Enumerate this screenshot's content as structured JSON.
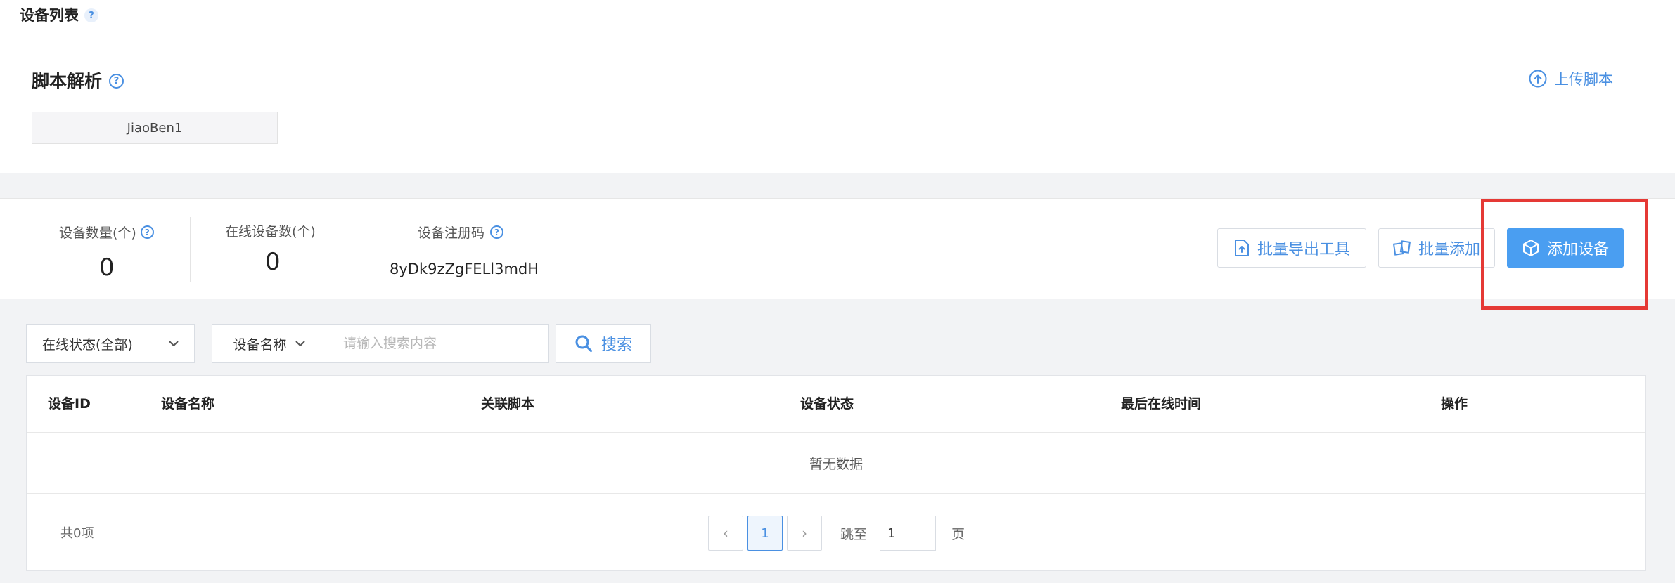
{
  "header": {
    "title": "设备列表",
    "help": "?"
  },
  "script_panel": {
    "title": "脚本解析",
    "help": "?",
    "script_name": "JiaoBen1",
    "upload_label": "上传脚本"
  },
  "stats": {
    "device_count_label": "设备数量(个)",
    "device_count_value": "0",
    "online_count_label": "在线设备数(个)",
    "online_count_value": "0",
    "reg_code_label": "设备注册码",
    "reg_code_value": "8yDk9zZgFELl3mdH",
    "help": "?"
  },
  "actions": {
    "export_tool": "批量导出工具",
    "batch_add": "批量添加",
    "add_device": "添加设备"
  },
  "filters": {
    "status_select": "在线状态(全部)",
    "field_select": "设备名称",
    "search_placeholder": "请输入搜索内容",
    "search_button": "搜索"
  },
  "table": {
    "columns": [
      "设备ID",
      "设备名称",
      "关联脚本",
      "设备状态",
      "最后在线时间",
      "操作"
    ],
    "empty_text": "暂无数据"
  },
  "pagination": {
    "total": "共0项",
    "prev": "‹",
    "current_page": "1",
    "next": "›",
    "jump_label": "跳至",
    "jump_value": "1",
    "page_suffix": "页"
  },
  "colors": {
    "accent": "#4a90e2",
    "primary_button": "#4a9ef1",
    "highlight": "#e53935"
  }
}
